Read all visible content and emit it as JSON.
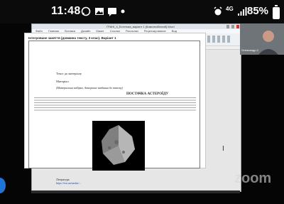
{
  "status_bar": {
    "time": "11:48",
    "signal": "4G",
    "battery": "85%"
  },
  "window": {
    "title": "ГРАНІ_4_Естетика_варіант 1 [Компатибілний] Word",
    "menu": [
      "Файл",
      "Главная",
      "Вставка",
      "Дизайн",
      "Макет",
      "Ссылки",
      "Рассылки",
      "Рецензирование",
      "Вид"
    ],
    "font_name": "Times New Ro"
  },
  "document": {
    "header": "Інтегроване заняття (довжина тексту, 3 клас). Варіант 1",
    "intro_line": "Текст до матеріалу",
    "sub_label": "Матеріал",
    "source_note": "(Матеріальна вибірка, Авторське завдання до тексту)",
    "article_title": "ПОСТАЧКА АСТЕРОЇДУ",
    "footer_label": "Література",
    "footer_url": "https://tsn.ua/nauka/..."
  },
  "participant": {
    "name": "Олександр С"
  },
  "watermark": "zoom",
  "colors": {
    "accent": "#1e74d8",
    "status_bg": "#0b0b0b",
    "asteroid": "#9a9a9a"
  }
}
